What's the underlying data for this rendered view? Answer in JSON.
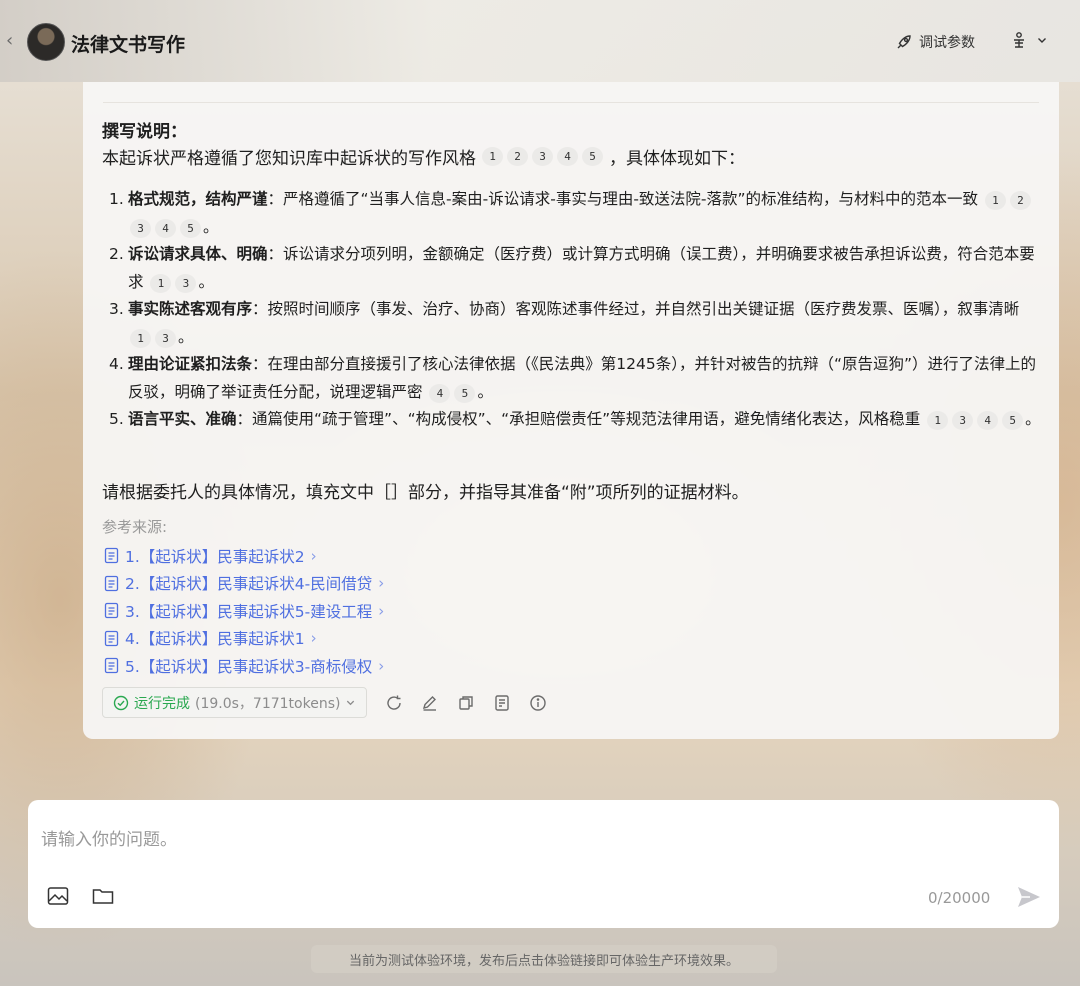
{
  "header": {
    "back_icon": "chevron-left-icon",
    "title": "法律文书写作",
    "tune_label": "调试参数",
    "tune_icon": "rocket-icon",
    "user_icon": "user-settings-icon"
  },
  "message": {
    "heading": "撰写说明：",
    "intro_prefix": "本起诉状严格遵循了您知识库中起诉状的写作风格",
    "intro_cites": [
      "1",
      "2",
      "3",
      "4",
      "5"
    ],
    "intro_suffix": "，具体体现如下：",
    "items": [
      {
        "num": "1.",
        "bold": "格式规范，结构严谨",
        "text": "：严格遵循了“当事人信息-案由-诉讼请求-事实与理由-致送法院-落款”的标准结构，与材料中的范本一致",
        "cites": [
          "1",
          "2",
          "3",
          "4",
          "5"
        ],
        "end": "。"
      },
      {
        "num": "2.",
        "bold": "诉讼请求具体、明确",
        "text": "：诉讼请求分项列明，金额确定（医疗费）或计算方式明确（误工费），并明确要求被告承担诉讼费，符合范本要求",
        "cites": [
          "1",
          "3"
        ],
        "end": "。"
      },
      {
        "num": "3.",
        "bold": "事实陈述客观有序",
        "text": "：按照时间顺序（事发、治疗、协商）客观陈述事件经过，并自然引出关键证据（医疗费发票、医嘱），叙事清晰",
        "cites": [
          "1",
          "3"
        ],
        "end": "。"
      },
      {
        "num": "4.",
        "bold": "理由论证紧扣法条",
        "text": "：在理由部分直接援引了核心法律依据（《民法典》第1245条），并针对被告的抗辩（“原告逗狗”）进行了法律上的反驳，明确了举证责任分配，说理逻辑严密",
        "cites": [
          "4",
          "5"
        ],
        "end": "。"
      },
      {
        "num": "5.",
        "bold": "语言平实、准确",
        "text": "：通篇使用“疏于管理”、“构成侵权”、“承担赔偿责任”等规范法律用语，避免情绪化表达，风格稳重",
        "cites": [
          "1",
          "3",
          "4",
          "5"
        ],
        "end": "。"
      }
    ],
    "closing": "请根据委托人的具体情况，填充文中［］部分，并指导其准备“附”项所列的证据材料。",
    "ref_title": "参考来源:",
    "refs": [
      "1.【起诉状】民事起诉状2",
      "2.【起诉状】民事起诉状4-民间借贷",
      "3.【起诉状】民事起诉状5-建设工程",
      "4.【起诉状】民事起诉状1",
      "5.【起诉状】民事起诉状3-商标侵权"
    ],
    "status": {
      "label": "运行完成",
      "meta": "(19.0s，7171tokens)"
    }
  },
  "composer": {
    "placeholder": "请输入你的问题。",
    "counter": "0/20000"
  },
  "notice": "当前为测试体验环境，发布后点击体验链接即可体验生产环境效果。",
  "colors": {
    "link": "#4f6fe0",
    "success": "#2aa850",
    "muted": "#999999"
  }
}
